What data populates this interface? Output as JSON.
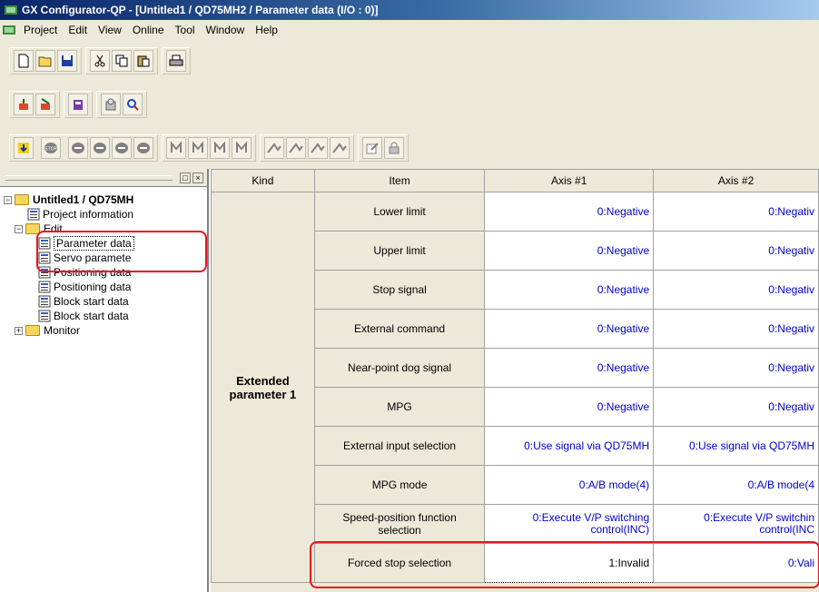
{
  "window": {
    "title": "GX Configurator-QP - [Untitled1 / QD75MH2 / Parameter data (I/O : 0)]"
  },
  "menu": [
    "Project",
    "Edit",
    "View",
    "Online",
    "Tool",
    "Window",
    "Help"
  ],
  "toolbar": {
    "row1": [
      "new-icon",
      "open-icon",
      "save-icon",
      "cut-icon",
      "copy-icon",
      "paste-icon",
      "print-icon"
    ],
    "row2": [
      "tool-a-icon",
      "tool-b-icon",
      "tool-c-icon",
      "tool-d-icon",
      "tool-e-icon"
    ],
    "row3": [
      "download-icon",
      "stop-icon",
      "jog-icon-1",
      "jog-icon-2",
      "jog-icon-3",
      "jog-icon-4",
      "mark-icon-1",
      "mark-icon-2",
      "mark-icon-3",
      "mark-icon-4",
      "axis-icon-1",
      "axis-icon-2",
      "axis-icon-3",
      "axis-icon-4",
      "edit-icon",
      "lock-icon"
    ]
  },
  "tree": {
    "root": "Untitled1 / QD75MH",
    "items": [
      "Project information"
    ],
    "edit": "Edit",
    "edit_children": [
      "Parameter data",
      "Servo paramete",
      "Positioning data",
      "Positioning data",
      "Block start data",
      "Block start data"
    ],
    "monitor": "Monitor"
  },
  "table": {
    "headers": [
      "Kind",
      "Item",
      "Axis #1",
      "Axis #2"
    ],
    "kind": "Extended parameter 1",
    "rows": [
      {
        "item": "Lower limit",
        "axis1": "0:Negative",
        "axis2": "0:Negativ"
      },
      {
        "item": "Upper limit",
        "axis1": "0:Negative",
        "axis2": "0:Negativ"
      },
      {
        "item": "Stop signal",
        "axis1": "0:Negative",
        "axis2": "0:Negativ"
      },
      {
        "item": "External command",
        "axis1": "0:Negative",
        "axis2": "0:Negativ"
      },
      {
        "item": "Near-point dog signal",
        "axis1": "0:Negative",
        "axis2": "0:Negativ"
      },
      {
        "item": "MPG",
        "axis1": "0:Negative",
        "axis2": "0:Negativ"
      },
      {
        "item": "External input selection",
        "axis1": "0:Use signal via QD75MH",
        "axis2": "0:Use signal via QD75MH"
      },
      {
        "item": "MPG mode",
        "axis1": "0:A/B mode(4)",
        "axis2": "0:A/B mode(4"
      },
      {
        "item": "Speed-position function selection",
        "axis1": "0:Execute V/P switching control(INC)",
        "axis2": "0:Execute V/P switchin control(INC"
      },
      {
        "item": "Forced stop selection",
        "axis1": "1:Invalid",
        "axis2": "0:Vali"
      }
    ]
  },
  "colors": {
    "highlight": "#e8141e",
    "value_text": "#0000cc",
    "titlebar": "#0a246a"
  }
}
